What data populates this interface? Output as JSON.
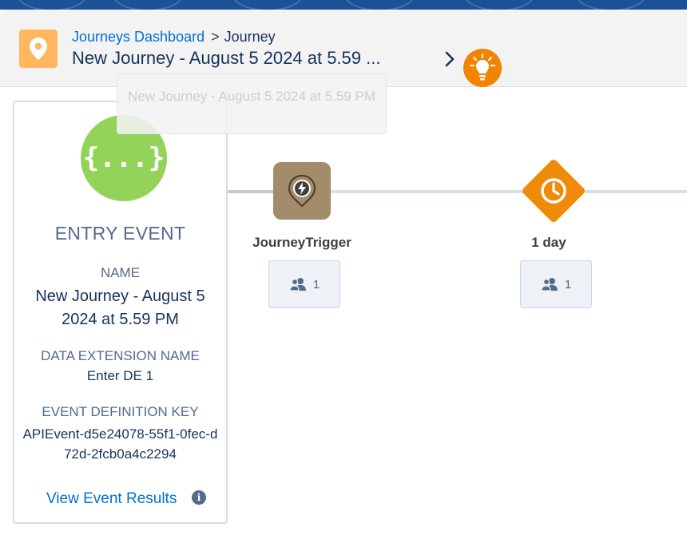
{
  "header": {
    "breadcrumb_link": "Journeys Dashboard",
    "breadcrumb_separator": ">",
    "breadcrumb_current": "Journey",
    "title": "New Journey - August 5 2024 at 5.59 ...",
    "app_icon": "location-pin-icon",
    "next_icon": "chevron-right-icon",
    "help_icon": "lightbulb-icon"
  },
  "tooltip": {
    "text": "New Journey - August 5 2024 at 5.59 PM"
  },
  "entry_event": {
    "icon": "braces-icon",
    "icon_text": "{...}",
    "heading": "ENTRY EVENT",
    "name_label": "NAME",
    "name_value": "New Journey - August 5 2024 at 5.59 PM",
    "de_label": "DATA EXTENSION NAME",
    "de_value": "Enter DE 1",
    "key_label": "EVENT DEFINITION KEY",
    "key_value": "APIEvent-d5e24078-55f1-0fec-d72d-2fcb0a4c2294",
    "link": "View Event Results",
    "info_icon": "info-icon",
    "info_glyph": "i"
  },
  "canvas": {
    "activities": [
      {
        "label": "JourneyTrigger",
        "icon": "journey-trigger-icon",
        "count": "1"
      },
      {
        "label": "1 day",
        "icon": "clock-icon",
        "count": "1"
      }
    ]
  },
  "colors": {
    "brand_blue": "#0070d2",
    "entry_green": "#93d35a",
    "wait_orange": "#f08b0a",
    "trigger_tan": "#a28c69",
    "app_icon_orange": "#ffb75d"
  }
}
